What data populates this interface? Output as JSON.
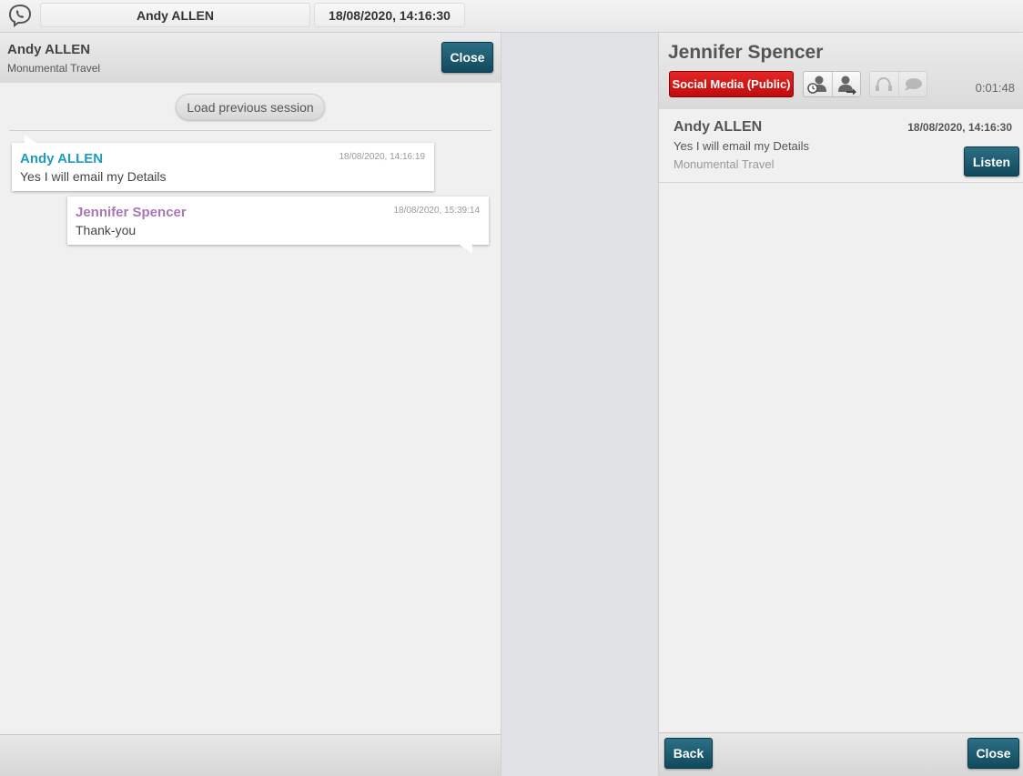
{
  "top_bar": {
    "contact_tab": "Andy ALLEN",
    "datetime_tab": "18/08/2020, 14:16:30"
  },
  "left_panel": {
    "contact_name": "Andy ALLEN",
    "contact_company": "Monumental Travel",
    "close_label": "Close",
    "load_previous_label": "Load previous session",
    "messages": [
      {
        "sender": "Andy ALLEN",
        "time": "18/08/2020, 14:16:19",
        "text": "Yes I will email my Details",
        "role": "customer"
      },
      {
        "sender": "Jennifer Spencer",
        "time": "18/08/2020, 15:39:14",
        "text": "Thank-you",
        "role": "agent"
      }
    ]
  },
  "right_panel": {
    "agent_name": "Jennifer Spencer",
    "channel_label": "Social Media (Public)",
    "timer": "0:01:48",
    "icons": [
      "person-clock-icon",
      "person-transfer-icon",
      "headset-icon",
      "chat-bubble-icon"
    ],
    "conversation": {
      "name": "Andy ALLEN",
      "time": "18/08/2020, 14:16:30",
      "message": "Yes I will email my Details",
      "company": "Monumental Travel",
      "listen_label": "Listen"
    },
    "back_label": "Back",
    "close_label": "Close"
  },
  "colors": {
    "customer_name": "#1d9bbf",
    "agent_name": "#a977b4",
    "button_dark": "#11495c",
    "channel_red": "#d41616"
  }
}
